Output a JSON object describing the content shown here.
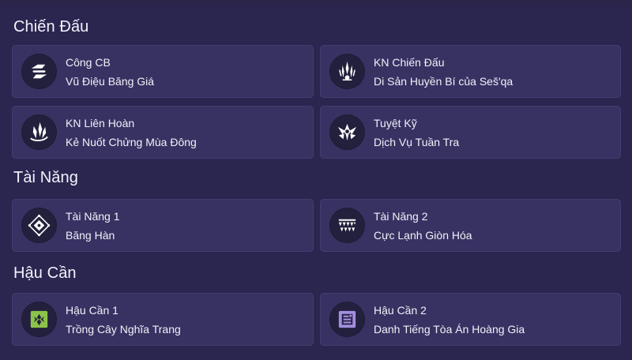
{
  "sections": [
    {
      "title": "Chiến Đấu"
    },
    {
      "title": "Tài Năng"
    },
    {
      "title": "Hậu Cần"
    }
  ],
  "cards": [
    {
      "label": "Công CB",
      "name": "Vũ Điệu Băng Giá",
      "icon": "arrows-swap-icon"
    },
    {
      "label": "KN Chiến Đấu",
      "name": "Di Sản Huyền Bí của Seš'qa",
      "icon": "ice-crystal-icon"
    },
    {
      "label": "KN Liên Hoàn",
      "name": "Kẻ Nuốt Chửng Mùa Đông",
      "icon": "ice-shards-icon"
    },
    {
      "label": "Tuyệt Kỹ",
      "name": "Dịch Vụ Tuần Tra",
      "icon": "winged-crest-icon"
    },
    {
      "label": "Tài Năng 1",
      "name": "Băng Hàn",
      "icon": "frost-diamond-icon"
    },
    {
      "label": "Tài Năng 2",
      "name": "Cực Lạnh Giòn Hóa",
      "icon": "spike-rows-icon"
    },
    {
      "label": "Hậu Cần 1",
      "name": "Trồng Cây Nghĩa Trang",
      "icon": "graveyard-plant-icon"
    },
    {
      "label": "Hậu Cần 2",
      "name": "Danh Tiếng Tòa Án Hoàng Gia",
      "icon": "royal-court-icon"
    }
  ],
  "colors": {
    "background": "#2b2650",
    "card": "#383263",
    "icon_bg": "#23203d",
    "logistics_green": "#8bc34a",
    "logistics_purple": "#a38ee0"
  }
}
